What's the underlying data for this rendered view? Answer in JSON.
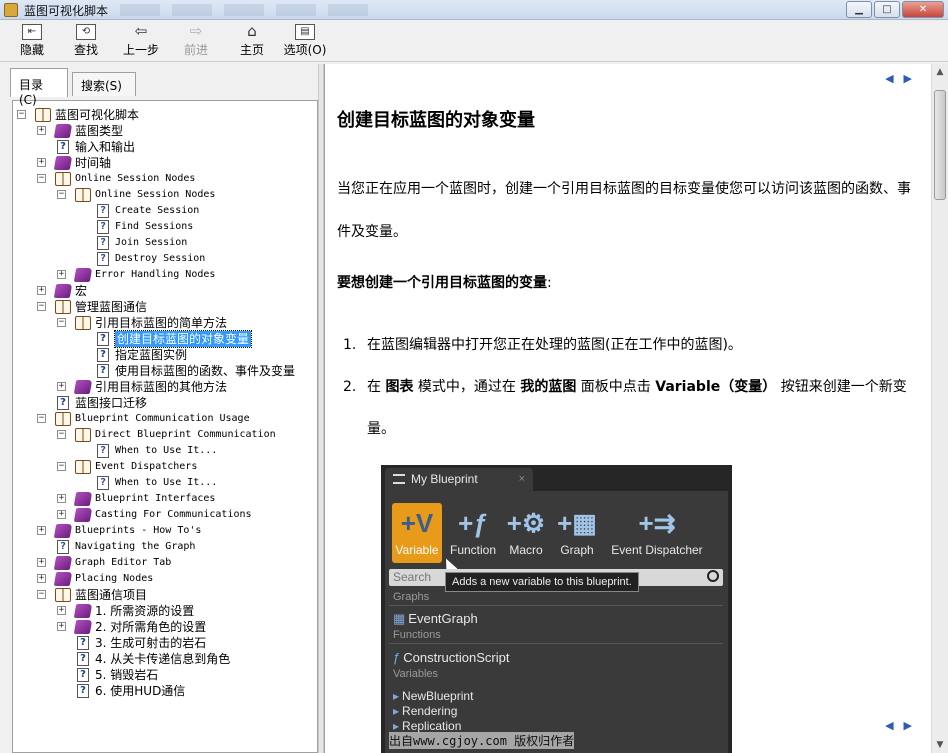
{
  "window": {
    "title": "蓝图可视化脚本"
  },
  "toolbar": {
    "buttons": [
      {
        "label": "隐藏",
        "icon": "hide-icon"
      },
      {
        "label": "查找",
        "icon": "locate-icon"
      },
      {
        "label": "上一步",
        "icon": "back-arrow-icon"
      },
      {
        "label": "前进",
        "icon": "forward-arrow-icon",
        "disabled": true
      },
      {
        "label": "主页",
        "icon": "home-icon"
      },
      {
        "label": "选项(O)",
        "icon": "options-icon"
      }
    ]
  },
  "tabs": {
    "contents": "目录(C)",
    "search": "搜索(S)"
  },
  "tree": [
    {
      "label": "蓝图可视化脚本",
      "depth": 0,
      "kind": "book-open",
      "exp": "−"
    },
    {
      "label": "蓝图类型",
      "depth": 1,
      "kind": "book-closed",
      "exp": "+"
    },
    {
      "label": "输入和输出",
      "depth": 1,
      "kind": "page"
    },
    {
      "label": "时间轴",
      "depth": 1,
      "kind": "book-closed",
      "exp": "+"
    },
    {
      "label": "Online Session Nodes",
      "depth": 1,
      "kind": "book-open",
      "exp": "−",
      "mono": true
    },
    {
      "label": "Online Session Nodes",
      "depth": 2,
      "kind": "book-open",
      "exp": "−",
      "mono": true
    },
    {
      "label": "Create Session",
      "depth": 3,
      "kind": "page",
      "mono": true
    },
    {
      "label": "Find Sessions",
      "depth": 3,
      "kind": "page",
      "mono": true
    },
    {
      "label": "Join Session",
      "depth": 3,
      "kind": "page",
      "mono": true
    },
    {
      "label": "Destroy Session",
      "depth": 3,
      "kind": "page",
      "mono": true
    },
    {
      "label": "Error Handling Nodes",
      "depth": 2,
      "kind": "book-closed",
      "exp": "+",
      "mono": true
    },
    {
      "label": "宏",
      "depth": 1,
      "kind": "book-closed",
      "exp": "+"
    },
    {
      "label": "管理蓝图通信",
      "depth": 1,
      "kind": "book-open",
      "exp": "−"
    },
    {
      "label": "引用目标蓝图的简单方法",
      "depth": 2,
      "kind": "book-open",
      "exp": "−"
    },
    {
      "label": "创建目标蓝图的对象变量",
      "depth": 3,
      "kind": "page",
      "selected": true
    },
    {
      "label": "指定蓝图实例",
      "depth": 3,
      "kind": "page"
    },
    {
      "label": "使用目标蓝图的函数、事件及变量",
      "depth": 3,
      "kind": "page"
    },
    {
      "label": "引用目标蓝图的其他方法",
      "depth": 2,
      "kind": "book-closed",
      "exp": "+"
    },
    {
      "label": "蓝图接口迁移",
      "depth": 1,
      "kind": "page"
    },
    {
      "label": "Blueprint Communication Usage",
      "depth": 1,
      "kind": "book-open",
      "exp": "−",
      "mono": true
    },
    {
      "label": "Direct Blueprint Communication",
      "depth": 2,
      "kind": "book-open",
      "exp": "−",
      "mono": true
    },
    {
      "label": "When to Use It...",
      "depth": 3,
      "kind": "page",
      "mono": true
    },
    {
      "label": "Event Dispatchers",
      "depth": 2,
      "kind": "book-open",
      "exp": "−",
      "mono": true
    },
    {
      "label": "When to Use It...",
      "depth": 3,
      "kind": "page",
      "mono": true
    },
    {
      "label": "Blueprint Interfaces",
      "depth": 2,
      "kind": "book-closed",
      "exp": "+",
      "mono": true
    },
    {
      "label": "Casting For Communications",
      "depth": 2,
      "kind": "book-closed",
      "exp": "+",
      "mono": true
    },
    {
      "label": "Blueprints - How To's",
      "depth": 1,
      "kind": "book-closed",
      "exp": "+",
      "mono": true
    },
    {
      "label": "Navigating the Graph",
      "depth": 1,
      "kind": "page",
      "mono": true
    },
    {
      "label": "Graph Editor Tab",
      "depth": 1,
      "kind": "book-closed",
      "exp": "+",
      "mono": true
    },
    {
      "label": "Placing Nodes",
      "depth": 1,
      "kind": "book-closed",
      "exp": "+",
      "mono": true
    },
    {
      "label": "蓝图通信项目",
      "depth": 1,
      "kind": "book-open",
      "exp": "−"
    },
    {
      "label": "1. 所需资源的设置",
      "depth": 2,
      "kind": "book-closed",
      "exp": "+"
    },
    {
      "label": "2. 对所需角色的设置",
      "depth": 2,
      "kind": "book-closed",
      "exp": "+"
    },
    {
      "label": "3. 生成可射击的岩石",
      "depth": 2,
      "kind": "page"
    },
    {
      "label": "4. 从关卡传递信息到角色",
      "depth": 2,
      "kind": "page"
    },
    {
      "label": "5. 销毁岩石",
      "depth": 2,
      "kind": "page"
    },
    {
      "label": "6. 使用HUD通信",
      "depth": 2,
      "kind": "page"
    }
  ],
  "article": {
    "title": "创建目标蓝图的对象变量",
    "intro": "当您正在应用一个蓝图时，创建一个引用目标蓝图的目标变量使您可以访问该蓝图的函数、事件及变量。",
    "subheading": "要想创建一个引用目标蓝图的变量",
    "subheading_suffix": ":",
    "steps": [
      {
        "num": "1.",
        "text": "在蓝图编辑器中打开您正在处理的蓝图(正在工作中的蓝图)。"
      },
      {
        "num": "2.",
        "pre": "在 ",
        "b1": "图表",
        "mid1": " 模式中，通过在 ",
        "b2": "我的蓝图",
        "mid2": " 面板中点击 ",
        "b3": "Variable（变量）",
        "post": " 按钮来创建一个新变量。"
      }
    ]
  },
  "ue_panel": {
    "tab_title": "My Blueprint",
    "tab_close": "×",
    "buttons": [
      "Variable",
      "Function",
      "Macro",
      "Graph",
      "Event Dispatcher"
    ],
    "search_placeholder": "Search",
    "tooltip": "Adds a new variable to this blueprint.",
    "sections": {
      "graphs": "Graphs",
      "functions": "Functions",
      "variables": "Variables"
    },
    "items": {
      "event_graph": "EventGraph",
      "construction": "ConstructionScript"
    },
    "variables": [
      "NewBlueprint",
      "Rendering",
      "Replication"
    ]
  },
  "watermark": "出自www.cgjoy.com 版权归作者"
}
